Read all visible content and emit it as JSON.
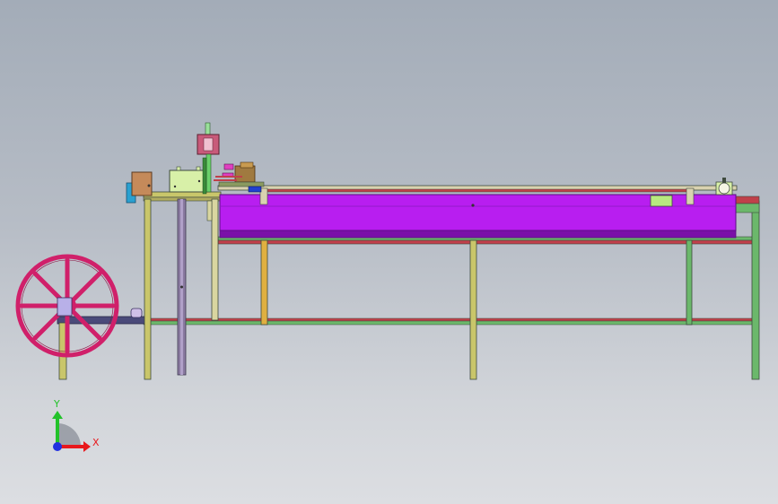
{
  "viewport": {
    "background_top": "#a3acb8",
    "background_bottom": "#dcdee2"
  },
  "triad": {
    "x_label": "X",
    "y_label": "Y",
    "x_color": "#e8181c",
    "y_color": "#22c22a",
    "z_color": "#2030e0"
  },
  "colors": {
    "tank_body": "#b81ef0",
    "tank_dark": "#7a10a8",
    "reel_wheel": "#d0206a",
    "frame": "#c9c66a",
    "frame_dark": "#3e4a3e",
    "rail_green": "#6bb86b",
    "rail_red": "#c0404a",
    "motor_box": "#c58a5a",
    "control_box": "#d8f0a8",
    "cylinder": "#c85a7a"
  }
}
